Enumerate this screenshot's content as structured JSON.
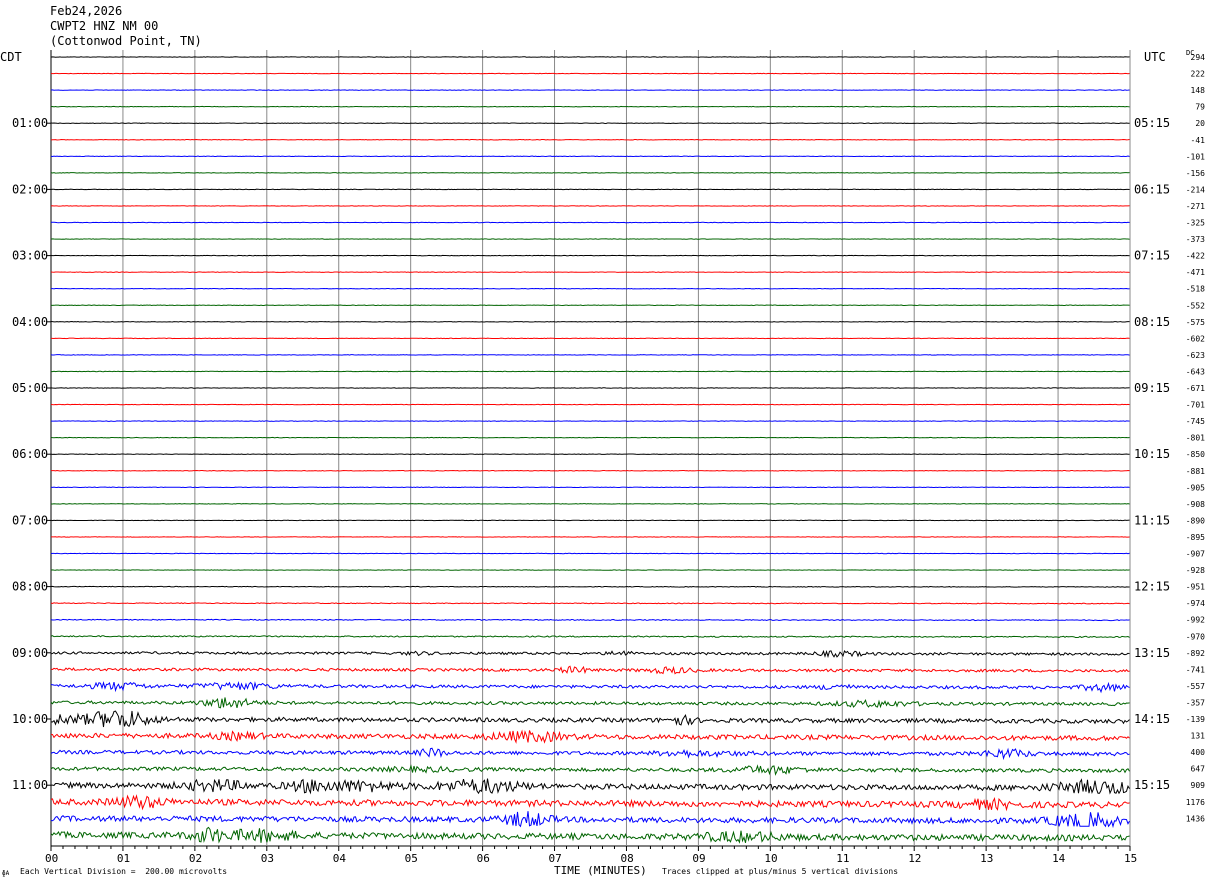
{
  "header": {
    "date": "Feb24,2026",
    "station": "CWPT2 HNZ NM 00",
    "location": "(Cottonwod Point, TN)"
  },
  "left_axis_label": "CDT",
  "right_axis_label": "UTC",
  "dc_label": "DC",
  "footer": {
    "scale_note": "Each Vertical Division =  200.00 microvolts",
    "clip_note": "Traces clipped at plus/minus 5 vertical divisions",
    "corner_mark": "ɸA"
  },
  "colors": {
    "trace_cycle": [
      "#000000",
      "#ff0000",
      "#0000ff",
      "#006400"
    ],
    "grid": "#888888"
  },
  "chart_data": {
    "type": "line",
    "title": "",
    "xlabel": "TIME (MINUTES)",
    "ylabel": "",
    "xlim": [
      0,
      15
    ],
    "x_ticks": [
      "00",
      "01",
      "02",
      "03",
      "04",
      "05",
      "06",
      "07",
      "08",
      "09",
      "10",
      "11",
      "12",
      "13",
      "14",
      "15"
    ],
    "left_hour_labels": [
      "01:00",
      "02:00",
      "03:00",
      "04:00",
      "05:00",
      "06:00",
      "07:00",
      "08:00",
      "09:00",
      "10:00",
      "11:00"
    ],
    "right_hour_labels": [
      "05:15",
      "06:15",
      "07:15",
      "08:15",
      "09:15",
      "10:15",
      "11:15",
      "12:15",
      "13:15",
      "14:15",
      "15:15"
    ],
    "dc_offsets": [
      294,
      222,
      148,
      79,
      20,
      -41,
      -101,
      -156,
      -214,
      -271,
      -325,
      -373,
      -422,
      -471,
      -518,
      -552,
      -575,
      -602,
      -623,
      -643,
      -671,
      -701,
      -745,
      -801,
      -850,
      -881,
      -905,
      -908,
      -890,
      -895,
      -907,
      -928,
      -951,
      -974,
      -992,
      -970,
      -892,
      -741,
      -557,
      -357,
      -139,
      131,
      400,
      647,
      909,
      1176,
      1436
    ],
    "trace_count": 48,
    "trace_interval_minutes": 15,
    "relative_activity": [
      0.08,
      0.08,
      0.08,
      0.08,
      0.08,
      0.08,
      0.08,
      0.08,
      0.08,
      0.08,
      0.08,
      0.08,
      0.08,
      0.08,
      0.08,
      0.08,
      0.08,
      0.08,
      0.08,
      0.08,
      0.08,
      0.08,
      0.08,
      0.08,
      0.08,
      0.08,
      0.08,
      0.08,
      0.08,
      0.08,
      0.08,
      0.08,
      0.1,
      0.12,
      0.15,
      0.2,
      0.4,
      0.45,
      0.5,
      0.5,
      0.7,
      0.8,
      0.6,
      0.6,
      0.9,
      1.0,
      0.9,
      1.0
    ]
  }
}
